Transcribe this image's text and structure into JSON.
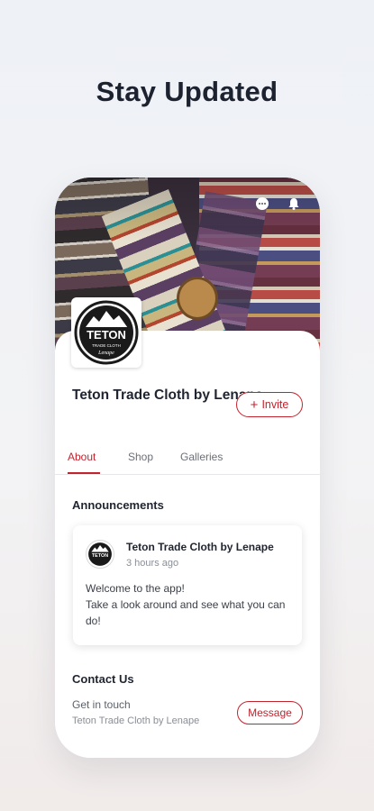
{
  "headline": "Stay Updated",
  "icons": {
    "chat": "chat-bubble-icon",
    "notifications": "bell-icon"
  },
  "logo": {
    "text": "TETON",
    "subtext": "TRADE CLOTH",
    "tagline": "Lenape"
  },
  "profile": {
    "name": "Teton Trade Cloth by Lenape",
    "invite_label": "Invite"
  },
  "tabs": [
    {
      "label": "About",
      "active": true
    },
    {
      "label": "Shop",
      "active": false
    },
    {
      "label": "Galleries",
      "active": false
    }
  ],
  "announcements": {
    "title": "Announcements",
    "post": {
      "author": "Teton Trade Cloth by Lenape",
      "time": "3 hours ago",
      "body": "Welcome to the app!\nTake a look around and see what you can do!"
    }
  },
  "contact": {
    "title": "Contact Us",
    "subtitle": "Get in touch",
    "name": "Teton Trade Cloth by Lenape",
    "message_label": "Message"
  },
  "colors": {
    "accent": "#c2242e",
    "text": "#1f2430",
    "muted": "#8a8e96"
  }
}
